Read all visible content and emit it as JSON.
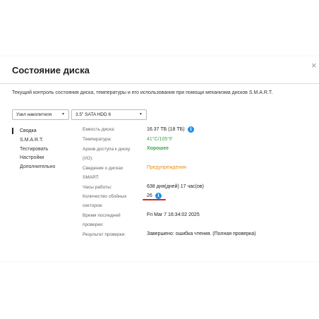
{
  "dialog": {
    "title": "Состояние диска",
    "close_glyph": "×"
  },
  "description": "Текущий контроль состояния диска, температуры и его использования при помощи механизма дисков S.M.A.R.T.",
  "selectors": {
    "node": "Узел накопителя",
    "disk": "3.5\" SATA HDD 6",
    "arrow_glyph": "▼"
  },
  "nav": {
    "items": [
      "Сводка",
      "S.M.A.R.T.",
      "Тестировать",
      "Настройки",
      "Дополнительно"
    ],
    "active": "Сводка"
  },
  "summary": {
    "capacity": {
      "label": "Емкость диска:",
      "value": "16.37 ТБ (18 ТБ)"
    },
    "temperature": {
      "label": "Температура:",
      "value": "41°C/105°F"
    },
    "io_archive": {
      "label_line1": "Архив доступа к диску",
      "label_line2": "(I/O):",
      "value": "Хорошее"
    },
    "smart_info": {
      "label_line1": "Сведения о дисках",
      "label_line2": "SMART:",
      "value": "Предупреждения"
    },
    "hours": {
      "label": "Часы работы:",
      "value": "638 дня(дней) 17 час(ов)"
    },
    "bad_sectors": {
      "label_line1": "Количество сбойных",
      "label_line2": "секторов:",
      "value": "26"
    },
    "last_check": {
      "label_line1": "Время последней",
      "label_line2": "проверки:",
      "value": "Fri Mar 7 16:34:02 2025"
    },
    "result": {
      "label": "Результат проверки:",
      "value": "Завершено: ошибка чтения. (Полная проверка)"
    }
  },
  "icons": {
    "info": "i"
  },
  "colors": {
    "good": "#3aa84a",
    "warning": "#e8901a",
    "info": "#1f8fea",
    "highlight": "#d32626"
  }
}
